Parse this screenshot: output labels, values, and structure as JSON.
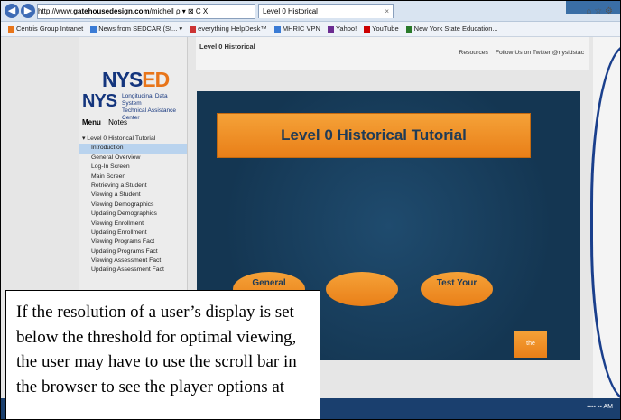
{
  "browser": {
    "url_prefix": "http://www.",
    "url_domain": "gatehousedesign.com",
    "url_rest": "/michell",
    "url_controls": "ρ ▾ ⊠ C X",
    "tab_title": "Level 0 Historical",
    "back_icon": "back-arrow-icon",
    "forward_icon": "forward-arrow-icon",
    "right_icons": "⌂ ☆ ⚙"
  },
  "favorites": [
    {
      "label": "Centris Group Intranet",
      "color": "#e8751a"
    },
    {
      "label": "News from SEDCAR (St...  ▾",
      "color": "#3a7bd5"
    },
    {
      "label": "everything HelpDesk™",
      "color": "#c33"
    },
    {
      "label": "MHRIC VPN",
      "color": "#3a7bd5"
    },
    {
      "label": "Yahoo!",
      "color": "#6b2c91"
    },
    {
      "label": "YouTube",
      "color": "#cc0000"
    },
    {
      "label": "New York State Education...",
      "color": "#2a7a2a"
    }
  ],
  "logo": {
    "nysed_main": "NYS",
    "nysed_ed": "ED",
    "nys": "NYS",
    "subtitle_1": "Longitudinal Data System",
    "subtitle_2": "Technical Assistance Center"
  },
  "menu": {
    "tab_menu": "Menu",
    "tab_notes": "Notes",
    "items": [
      "▾ Level 0 Historical Tutorial",
      "Introduction",
      "General Overview",
      "Log-In Screen",
      "Main Screen",
      "Retrieving a Student",
      "Viewing a Student",
      "Viewing Demographics",
      "Updating Demographics",
      "Viewing Enrollment",
      "Updating Enrollment",
      "Viewing Programs Fact",
      "Updating Programs Fact",
      "Viewing Assessment Fact",
      "Updating Assessment Fact"
    ],
    "selected_index": 1
  },
  "content": {
    "title": "Level 0 Historical",
    "link_resources": "Resources",
    "link_twitter": "Follow Us on Twitter @nysldstac"
  },
  "slide": {
    "title": "Level 0 Historical Tutorial",
    "buttons": [
      "General",
      "",
      "Test Your"
    ],
    "corner_button": "the"
  },
  "callout": {
    "text": "If the resolution of a user’s display is set below the threshold for optimal viewing, the user may have to use the scroll bar in the browser to see the player options at"
  },
  "colors": {
    "accent_orange": "#e97f18",
    "brand_blue": "#14357d",
    "slide_bg": "#143652",
    "annotation_blue": "#1a3f8c"
  }
}
